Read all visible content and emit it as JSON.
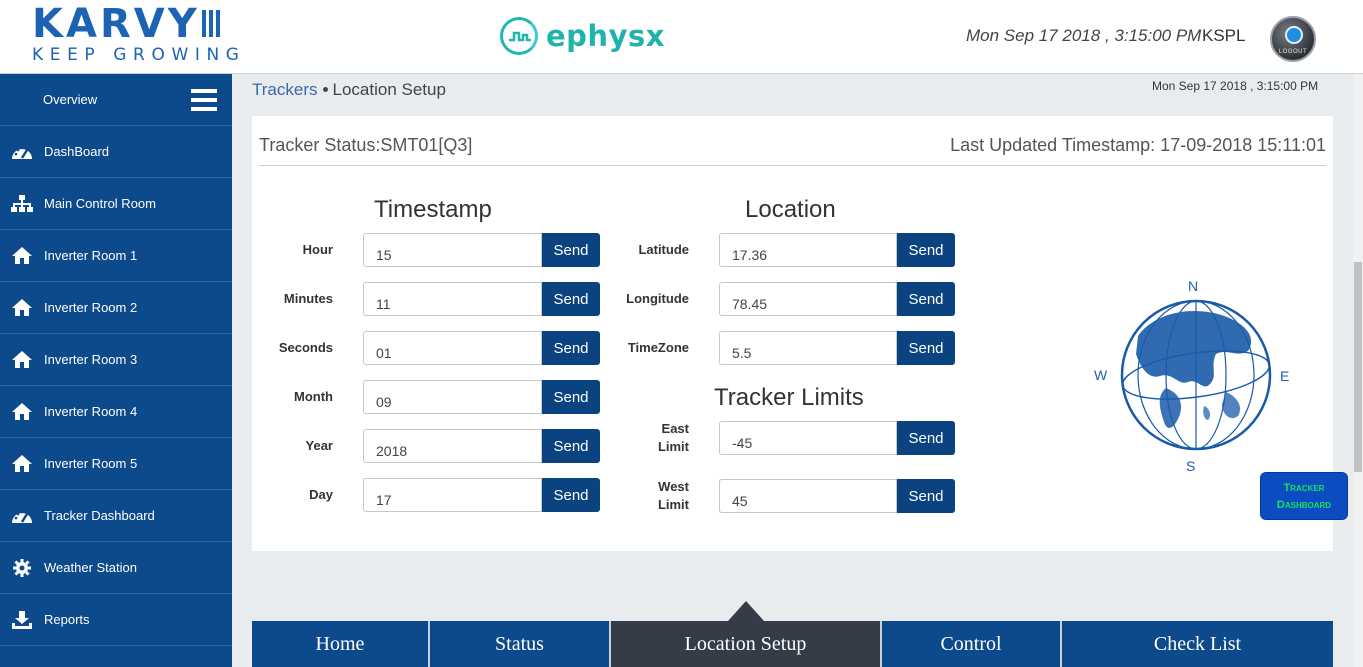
{
  "header": {
    "brand_name": "KARVY",
    "brand_tagline": "KEEP GROWING",
    "product_name": "ephysx",
    "datetime": "Mon Sep 17 2018 , 3:15:00 PM",
    "user": "KSPL",
    "logout_label": "LOGOUT"
  },
  "sidebar": {
    "overview_label": "Overview",
    "items": [
      {
        "label": "DashBoard",
        "icon": "dashboard-gauge-icon"
      },
      {
        "label": "Main Control Room",
        "icon": "sitemap-icon"
      },
      {
        "label": "Inverter Room 1",
        "icon": "home-icon"
      },
      {
        "label": "Inverter Room 2",
        "icon": "home-icon"
      },
      {
        "label": "Inverter Room 3",
        "icon": "home-icon"
      },
      {
        "label": "Inverter Room 4",
        "icon": "home-icon"
      },
      {
        "label": "Inverter Room 5",
        "icon": "home-icon"
      },
      {
        "label": "Tracker Dashboard",
        "icon": "dashboard-gauge-icon"
      },
      {
        "label": "Weather Station",
        "icon": "gear-icon"
      },
      {
        "label": "Reports",
        "icon": "download-icon"
      }
    ]
  },
  "breadcrumb": {
    "parent": "Trackers",
    "current": "Location Setup"
  },
  "sub_datetime": "Mon Sep 17 2018 , 3:15:00 PM",
  "panel": {
    "tracker_status": "Tracker Status:SMT01[Q3]",
    "last_updated": "Last Updated Timestamp: 17-09-2018 15:11:01",
    "send_label": "Send",
    "timestamp": {
      "title": "Timestamp",
      "fields": [
        {
          "label": "Hour",
          "value": "15"
        },
        {
          "label": "Minutes",
          "value": "11"
        },
        {
          "label": "Seconds",
          "value": "01"
        },
        {
          "label": "Month",
          "value": "09"
        },
        {
          "label": "Year",
          "value": "2018"
        },
        {
          "label": "Day",
          "value": "17"
        }
      ]
    },
    "location": {
      "title": "Location",
      "fields": [
        {
          "label": "Latitude",
          "value": "17.36"
        },
        {
          "label": "Longitude",
          "value": "78.45"
        },
        {
          "label": "TimeZone",
          "value": "5.5"
        }
      ]
    },
    "limits": {
      "title": "Tracker Limits",
      "fields": [
        {
          "label_line1": "East",
          "label_line2": "Limit",
          "value": "-45"
        },
        {
          "label_line1": "West",
          "label_line2": "Limit",
          "value": "45"
        }
      ]
    },
    "compass": {
      "n": "N",
      "s": "S",
      "e": "E",
      "w": "W"
    }
  },
  "tracker_dashboard_button": {
    "line1": "Tracker",
    "line2": "Dashboard"
  },
  "bottom_tabs": [
    {
      "label": "Home",
      "active": false
    },
    {
      "label": "Status",
      "active": false
    },
    {
      "label": "Location Setup",
      "active": true
    },
    {
      "label": "Control",
      "active": false
    },
    {
      "label": "Check List",
      "active": false
    }
  ],
  "colors": {
    "brand_blue": "#1d63b4",
    "sidebar": "#0d4a8c",
    "ephysx_teal": "#1fb3ab",
    "active_tab": "#333c47"
  }
}
